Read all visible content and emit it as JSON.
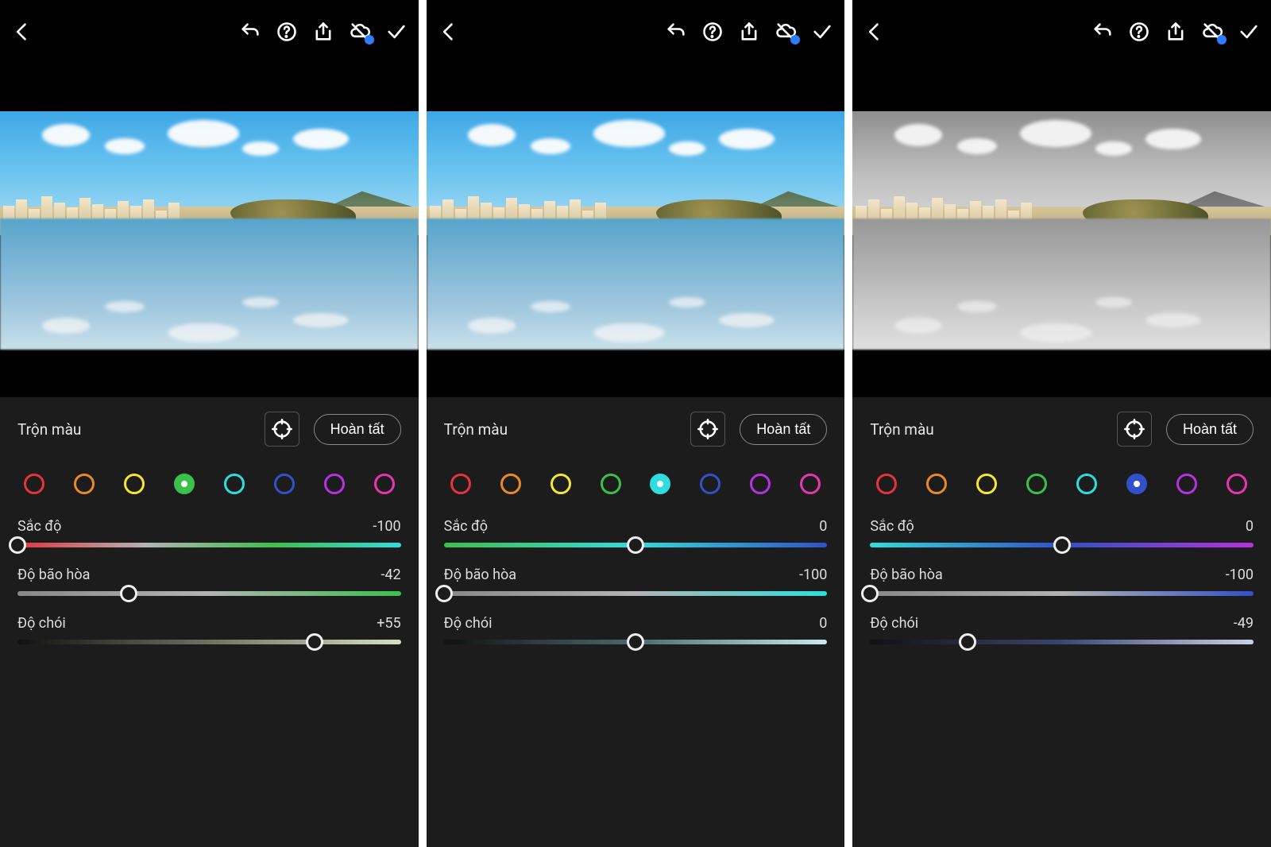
{
  "common": {
    "panel_title": "Trộn màu",
    "done_label": "Hoàn tất",
    "slider_labels": {
      "hue": "Sắc độ",
      "sat": "Độ bão hòa",
      "lum": "Độ chói"
    },
    "swatch_colors": [
      {
        "name": "red",
        "hex": "#e5343e"
      },
      {
        "name": "orange",
        "hex": "#e88a2a"
      },
      {
        "name": "yellow",
        "hex": "#f3e82d"
      },
      {
        "name": "green",
        "hex": "#3bc04b"
      },
      {
        "name": "aqua",
        "hex": "#2edddd"
      },
      {
        "name": "blue",
        "hex": "#3250c9"
      },
      {
        "name": "purple",
        "hex": "#b432e0"
      },
      {
        "name": "magenta",
        "hex": "#e535b0"
      }
    ]
  },
  "screens": [
    {
      "id": "s1",
      "image_variant": "color",
      "selected_swatch": "green",
      "sliders": {
        "hue": {
          "value": -100,
          "display": "-100",
          "grad": [
            "#e5343e",
            "#b3b3b3",
            "#3bc04b",
            "#2edddd"
          ],
          "left_dim": 1
        },
        "sat": {
          "value": -42,
          "display": "-42",
          "grad": [
            "#888",
            "#b3b3b3",
            "#3bc04b"
          ],
          "left_dim": 1
        },
        "lum": {
          "value": 55,
          "display": "+55",
          "grad": [
            "#111",
            "#707060",
            "#d6e0c2"
          ],
          "left_dim": 0
        }
      }
    },
    {
      "id": "s2",
      "image_variant": "color",
      "selected_swatch": "aqua",
      "sliders": {
        "hue": {
          "value": 0,
          "display": "0",
          "grad": [
            "#3bc04b",
            "#2edddd",
            "#3250c9"
          ]
        },
        "sat": {
          "value": -100,
          "display": "-100",
          "grad": [
            "#888",
            "#b3b3b3",
            "#2edddd"
          ]
        },
        "lum": {
          "value": 0,
          "display": "0",
          "grad": [
            "#111",
            "#4c6a6a",
            "#c9eaea"
          ]
        }
      }
    },
    {
      "id": "s3",
      "image_variant": "gray",
      "selected_swatch": "blue",
      "sliders": {
        "hue": {
          "value": 0,
          "display": "0",
          "grad": [
            "#2edddd",
            "#3250c9",
            "#b432e0"
          ]
        },
        "sat": {
          "value": -100,
          "display": "-100",
          "grad": [
            "#888",
            "#b3b3b3",
            "#3250c9"
          ]
        },
        "lum": {
          "value": -49,
          "display": "-49",
          "grad": [
            "#111",
            "#3b4570",
            "#c9d2ea"
          ]
        }
      }
    }
  ]
}
